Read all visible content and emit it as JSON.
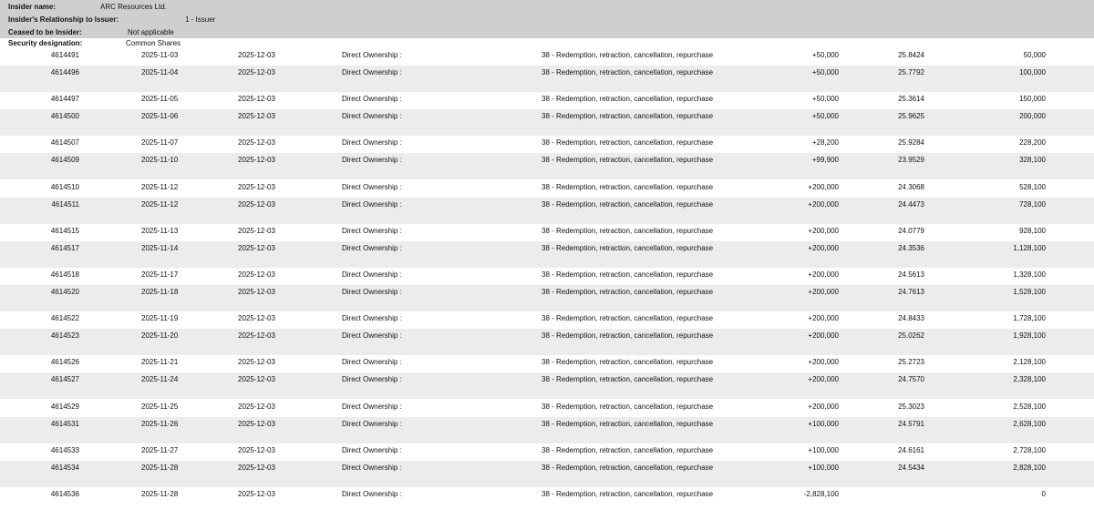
{
  "header": {
    "insider_name_label": "Insider name:",
    "insider_name": "ARC Resources Ltd.",
    "relationship_label": "Insider's Relationship to Issuer:",
    "relationship": "1 - Issuer",
    "ceased_label": "Ceased to be Insider:",
    "ceased": "Not applicable",
    "security_label": "Security designation:",
    "security": "Common Shares"
  },
  "transactions": [
    {
      "id": "4614491",
      "date": "2025-11-03",
      "filing_date": "2025-12-03",
      "ownership": "Direct Ownership :",
      "nature": "38 - Redemption, retraction, cancellation, repurchase",
      "quantity": "+50,000",
      "price": "25.8424",
      "balance": "50,000"
    },
    {
      "id": "4614496",
      "date": "2025-11-04",
      "filing_date": "2025-12-03",
      "ownership": "Direct Ownership :",
      "nature": "38 - Redemption, retraction, cancellation, repurchase",
      "quantity": "+50,000",
      "price": "25.7792",
      "balance": "100,000"
    },
    {
      "id": "4614497",
      "date": "2025-11-05",
      "filing_date": "2025-12-03",
      "ownership": "Direct Ownership :",
      "nature": "38 - Redemption, retraction, cancellation, repurchase",
      "quantity": "+50,000",
      "price": "25.3614",
      "balance": "150,000"
    },
    {
      "id": "4614500",
      "date": "2025-11-06",
      "filing_date": "2025-12-03",
      "ownership": "Direct Ownership :",
      "nature": "38 - Redemption, retraction, cancellation, repurchase",
      "quantity": "+50,000",
      "price": "25.9625",
      "balance": "200,000"
    },
    {
      "id": "4614507",
      "date": "2025-11-07",
      "filing_date": "2025-12-03",
      "ownership": "Direct Ownership :",
      "nature": "38 - Redemption, retraction, cancellation, repurchase",
      "quantity": "+28,200",
      "price": "25.9284",
      "balance": "228,200"
    },
    {
      "id": "4614509",
      "date": "2025-11-10",
      "filing_date": "2025-12-03",
      "ownership": "Direct Ownership :",
      "nature": "38 - Redemption, retraction, cancellation, repurchase",
      "quantity": "+99,900",
      "price": "23.9529",
      "balance": "328,100"
    },
    {
      "id": "4614510",
      "date": "2025-11-12",
      "filing_date": "2025-12-03",
      "ownership": "Direct Ownership :",
      "nature": "38 - Redemption, retraction, cancellation, repurchase",
      "quantity": "+200,000",
      "price": "24.3068",
      "balance": "528,100"
    },
    {
      "id": "4614511",
      "date": "2025-11-12",
      "filing_date": "2025-12-03",
      "ownership": "Direct Ownership :",
      "nature": "38 - Redemption, retraction, cancellation, repurchase",
      "quantity": "+200,000",
      "price": "24.4473",
      "balance": "728,100"
    },
    {
      "id": "4614515",
      "date": "2025-11-13",
      "filing_date": "2025-12-03",
      "ownership": "Direct Ownership :",
      "nature": "38 - Redemption, retraction, cancellation, repurchase",
      "quantity": "+200,000",
      "price": "24.0779",
      "balance": "928,100"
    },
    {
      "id": "4614517",
      "date": "2025-11-14",
      "filing_date": "2025-12-03",
      "ownership": "Direct Ownership :",
      "nature": "38 - Redemption, retraction, cancellation, repurchase",
      "quantity": "+200,000",
      "price": "24.3536",
      "balance": "1,128,100"
    },
    {
      "id": "4614518",
      "date": "2025-11-17",
      "filing_date": "2025-12-03",
      "ownership": "Direct Ownership :",
      "nature": "38 - Redemption, retraction, cancellation, repurchase",
      "quantity": "+200,000",
      "price": "24.5613",
      "balance": "1,328,100"
    },
    {
      "id": "4614520",
      "date": "2025-11-18",
      "filing_date": "2025-12-03",
      "ownership": "Direct Ownership :",
      "nature": "38 - Redemption, retraction, cancellation, repurchase",
      "quantity": "+200,000",
      "price": "24.7613",
      "balance": "1,528,100"
    },
    {
      "id": "4614522",
      "date": "2025-11-19",
      "filing_date": "2025-12-03",
      "ownership": "Direct Ownership :",
      "nature": "38 - Redemption, retraction, cancellation, repurchase",
      "quantity": "+200,000",
      "price": "24.8433",
      "balance": "1,728,100"
    },
    {
      "id": "4614523",
      "date": "2025-11-20",
      "filing_date": "2025-12-03",
      "ownership": "Direct Ownership :",
      "nature": "38 - Redemption, retraction, cancellation, repurchase",
      "quantity": "+200,000",
      "price": "25.0262",
      "balance": "1,928,100"
    },
    {
      "id": "4614526",
      "date": "2025-11-21",
      "filing_date": "2025-12-03",
      "ownership": "Direct Ownership :",
      "nature": "38 - Redemption, retraction, cancellation, repurchase",
      "quantity": "+200,000",
      "price": "25.2723",
      "balance": "2,128,100"
    },
    {
      "id": "4614527",
      "date": "2025-11-24",
      "filing_date": "2025-12-03",
      "ownership": "Direct Ownership :",
      "nature": "38 - Redemption, retraction, cancellation, repurchase",
      "quantity": "+200,000",
      "price": "24.7570",
      "balance": "2,328,100"
    },
    {
      "id": "4614529",
      "date": "2025-11-25",
      "filing_date": "2025-12-03",
      "ownership": "Direct Ownership :",
      "nature": "38 - Redemption, retraction, cancellation, repurchase",
      "quantity": "+200,000",
      "price": "25.3023",
      "balance": "2,528,100"
    },
    {
      "id": "4614531",
      "date": "2025-11-26",
      "filing_date": "2025-12-03",
      "ownership": "Direct Ownership :",
      "nature": "38 - Redemption, retraction, cancellation, repurchase",
      "quantity": "+100,000",
      "price": "24.5791",
      "balance": "2,628,100"
    },
    {
      "id": "4614533",
      "date": "2025-11-27",
      "filing_date": "2025-12-03",
      "ownership": "Direct Ownership :",
      "nature": "38 - Redemption, retraction, cancellation, repurchase",
      "quantity": "+100,000",
      "price": "24.6161",
      "balance": "2,728,100"
    },
    {
      "id": "4614534",
      "date": "2025-11-28",
      "filing_date": "2025-12-03",
      "ownership": "Direct Ownership :",
      "nature": "38 - Redemption, retraction, cancellation, repurchase",
      "quantity": "+100,000",
      "price": "24.5434",
      "balance": "2,828,100"
    },
    {
      "id": "4614536",
      "date": "2025-11-28",
      "filing_date": "2025-12-03",
      "ownership": "Direct Ownership :",
      "nature": "38 - Redemption, retraction, cancellation, repurchase",
      "quantity": "-2,828,100",
      "price": "",
      "balance": "0"
    }
  ]
}
